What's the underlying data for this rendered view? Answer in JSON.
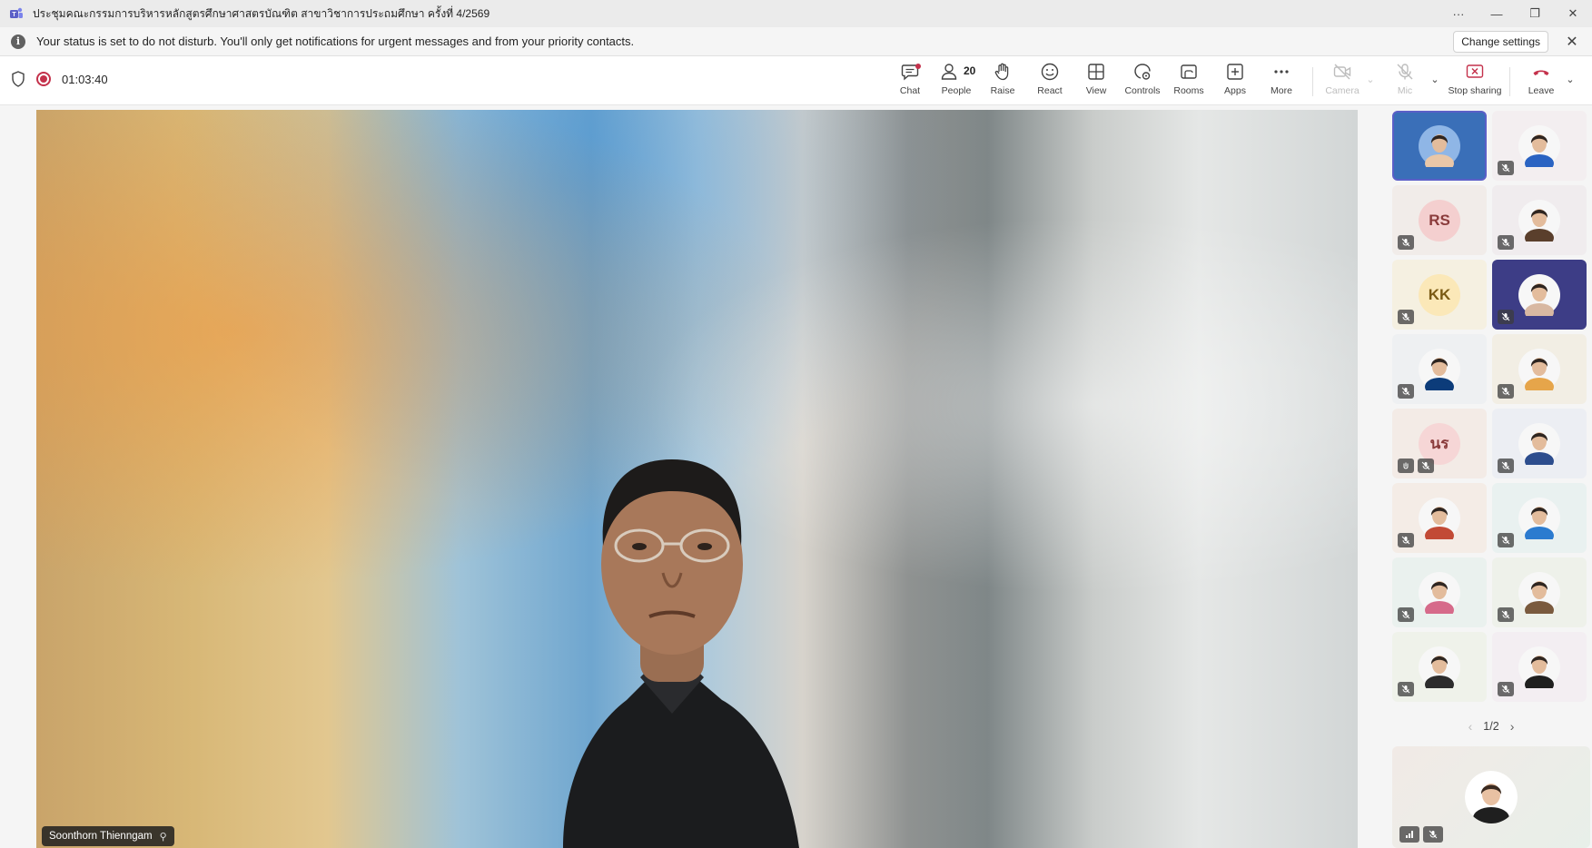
{
  "window": {
    "title": "ประชุมคณะกรรมการบริหารหลักสูตรศึกษาศาสตรบัณฑิต สาขาวิชาการประถมศึกษา ครั้งที่ 4/2569",
    "controls": {
      "more": "···",
      "minimize": "—",
      "restore": "❐",
      "close": "✕"
    }
  },
  "notification": {
    "info_glyph": "i",
    "message": "Your status is set to do not disturb. You'll only get notifications for urgent messages and from your priority contacts.",
    "button_label": "Change settings",
    "close_glyph": "✕"
  },
  "toolbar": {
    "timer": "01:03:40",
    "items": {
      "chat": "Chat",
      "people": "People",
      "people_count": "20",
      "raise": "Raise",
      "react": "React",
      "view": "View",
      "controls": "Controls",
      "rooms": "Rooms",
      "apps": "Apps",
      "more": "More",
      "camera": "Camera",
      "mic": "Mic",
      "stop_sharing": "Stop sharing",
      "leave": "Leave"
    },
    "chevron": "⌄"
  },
  "main_video": {
    "participant_name": "Soonthorn Thienngam",
    "pin_glyph": "⚲"
  },
  "gallery": {
    "tiles": [
      {
        "kind": "photo",
        "bg": "#3a6fb8",
        "face": "#e9c7a8",
        "muted": false,
        "selected": true
      },
      {
        "kind": "photo",
        "bg": "#f3eef0",
        "face": "#2a63c2",
        "muted": true
      },
      {
        "kind": "initials",
        "initials": "RS",
        "bg": "#f1ece9",
        "circle": "#f4cfcf",
        "color": "#8a3b3b",
        "muted": true
      },
      {
        "kind": "photo",
        "bg": "#f0ecee",
        "face": "#5a3f2c",
        "muted": true
      },
      {
        "kind": "initials",
        "initials": "KK",
        "bg": "#f5f0e1",
        "circle": "#fbe8b8",
        "color": "#7a5a14",
        "muted": true
      },
      {
        "kind": "photo",
        "bg": "#3d3d86",
        "face": "#d8b8a2",
        "muted": true
      },
      {
        "kind": "photo",
        "bg": "#eef0f2",
        "face": "#0c3c7a",
        "muted": true
      },
      {
        "kind": "photo",
        "bg": "#f2eee4",
        "face": "#e6a54a",
        "muted": true
      },
      {
        "kind": "initials",
        "initials": "นร",
        "bg": "#f3ebe6",
        "circle": "#f6d6d6",
        "color": "#8a3b3b",
        "muted": true,
        "extra_badge": true
      },
      {
        "kind": "photo",
        "bg": "#eceef3",
        "face": "#2d4d8d",
        "muted": true
      },
      {
        "kind": "photo",
        "bg": "#f4ece6",
        "face": "#c24a35",
        "muted": true
      },
      {
        "kind": "photo",
        "bg": "#e9f1f0",
        "face": "#2b7bcf",
        "muted": true
      },
      {
        "kind": "photo",
        "bg": "#eaf1ee",
        "face": "#d66a8a",
        "muted": true
      },
      {
        "kind": "photo",
        "bg": "#eef1ea",
        "face": "#7a5a3e",
        "muted": true
      },
      {
        "kind": "photo",
        "bg": "#eff2ea",
        "face": "#2c2c2c",
        "muted": true
      },
      {
        "kind": "photo",
        "bg": "#f3eef2",
        "face": "#1f1f1f",
        "muted": true
      }
    ],
    "pager": {
      "text": "1/2",
      "prev": "‹",
      "next": "›"
    }
  },
  "colors": {
    "accent": "#5b5fc7",
    "record": "#c4314b",
    "leave": "#c4314b"
  }
}
